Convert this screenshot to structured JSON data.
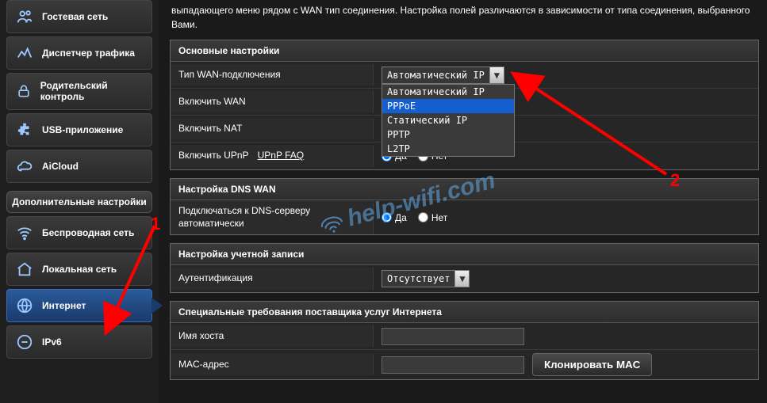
{
  "intro": "выпадающего меню рядом с WAN тип соединения. Настройка полей различаются в зависимости от типа соединения, выбранного Вами.",
  "sidebar": {
    "items": [
      {
        "label": "Гостевая сеть",
        "icon": "users"
      },
      {
        "label": "Диспетчер трафика",
        "icon": "traffic"
      },
      {
        "label": "Родительский контроль",
        "icon": "lock"
      },
      {
        "label": "USB-приложение",
        "icon": "puzzle"
      },
      {
        "label": "AiCloud",
        "icon": "cloud"
      }
    ],
    "section_header": "Дополнительные настройки",
    "items2": [
      {
        "label": "Беспроводная сеть",
        "icon": "wifi"
      },
      {
        "label": "Локальная сеть",
        "icon": "home"
      },
      {
        "label": "Интернет",
        "icon": "globe",
        "active": true
      },
      {
        "label": "IPv6",
        "icon": "ipv6"
      }
    ]
  },
  "panels": {
    "basic": {
      "title": "Основные настройки",
      "wan_type_label": "Тип WAN-подключения",
      "wan_type_value": "Автоматический IP",
      "wan_type_options": [
        "Автоматический IP",
        "PPPoE",
        "Статический IP",
        "PPTP",
        "L2TP"
      ],
      "enable_wan_label": "Включить WAN",
      "enable_nat_label": "Включить NAT",
      "enable_upnp_label": "Включить UPnP",
      "upnp_faq": "UPnP FAQ",
      "yes": "Да",
      "no": "Нет"
    },
    "dns": {
      "title": "Настройка DNS WAN",
      "auto_label": "Подключаться к DNS-серверу автоматически",
      "yes": "Да",
      "no": "Нет"
    },
    "account": {
      "title": "Настройка учетной записи",
      "auth_label": "Аутентификация",
      "auth_value": "Отсутствует"
    },
    "isp": {
      "title": "Специальные требования поставщика услуг Интернета",
      "host_label": "Имя хоста",
      "mac_label": "MAC-адрес",
      "clone_btn": "Клонировать MAC"
    }
  },
  "annotations": {
    "one": "1",
    "two": "2"
  },
  "watermark": "help-wifi.com"
}
